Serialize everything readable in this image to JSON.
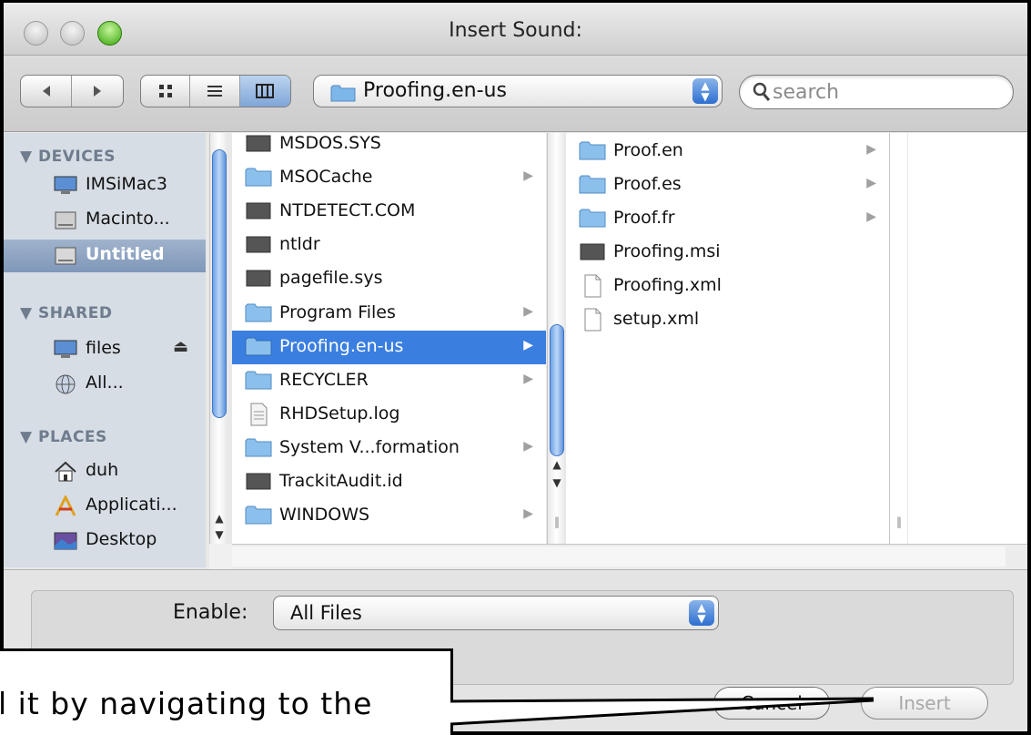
{
  "window": {
    "title": "Insert Sound:"
  },
  "toolbar": {
    "back_icon": "back-arrow-icon",
    "forward_icon": "forward-arrow-icon",
    "location": "Proofing.en-us",
    "search_placeholder": "search"
  },
  "sidebar": {
    "sections": [
      {
        "label": "▼ DEVICES"
      },
      {
        "label": "▼ SHARED"
      },
      {
        "label": "▼ PLACES"
      }
    ],
    "items": [
      {
        "label": "IMSiMac3",
        "icon": "computer-icon"
      },
      {
        "label": "Macinto...",
        "icon": "hard-drive-icon"
      },
      {
        "label": "Untitled",
        "icon": "hard-drive-icon"
      },
      {
        "label": "files",
        "icon": "network-computer-icon"
      },
      {
        "label": "All...",
        "icon": "network-globe-icon"
      },
      {
        "label": "duh",
        "icon": "home-icon"
      },
      {
        "label": "Applicati...",
        "icon": "applications-icon"
      },
      {
        "label": "Desktop",
        "icon": "desktop-icon"
      }
    ],
    "eject_symbol": "⏏"
  },
  "column1": {
    "rows": [
      {
        "name": "MSDOS.SYS",
        "type": "system"
      },
      {
        "name": "MSOCache",
        "type": "folder"
      },
      {
        "name": "NTDETECT.COM",
        "type": "system"
      },
      {
        "name": "ntldr",
        "type": "system"
      },
      {
        "name": "pagefile.sys",
        "type": "system"
      },
      {
        "name": "Program Files",
        "type": "folder"
      },
      {
        "name": "Proofing.en-us",
        "type": "folder"
      },
      {
        "name": "RECYCLER",
        "type": "folder"
      },
      {
        "name": "RHDSetup.log",
        "type": "document"
      },
      {
        "name": "System V...formation",
        "type": "folder"
      },
      {
        "name": "TrackitAudit.id",
        "type": "system"
      },
      {
        "name": "WINDOWS",
        "type": "folder"
      }
    ]
  },
  "column2": {
    "rows": [
      {
        "name": "Proof.en",
        "type": "folder"
      },
      {
        "name": "Proof.es",
        "type": "folder"
      },
      {
        "name": "Proof.fr",
        "type": "folder"
      },
      {
        "name": "Proofing.msi",
        "type": "system"
      },
      {
        "name": "Proofing.xml",
        "type": "document"
      },
      {
        "name": "setup.xml",
        "type": "document"
      }
    ]
  },
  "footer": {
    "enable_label": "Enable:",
    "enable_value": "All Files",
    "cancel_label": "Cancel",
    "insert_label": "Insert"
  },
  "callout": {
    "text": "l it by navigating to the"
  },
  "colors": {
    "selection": "#3a7ee0",
    "sidebar_bg": "#d6dde5",
    "accent_green": "#37a50c"
  }
}
